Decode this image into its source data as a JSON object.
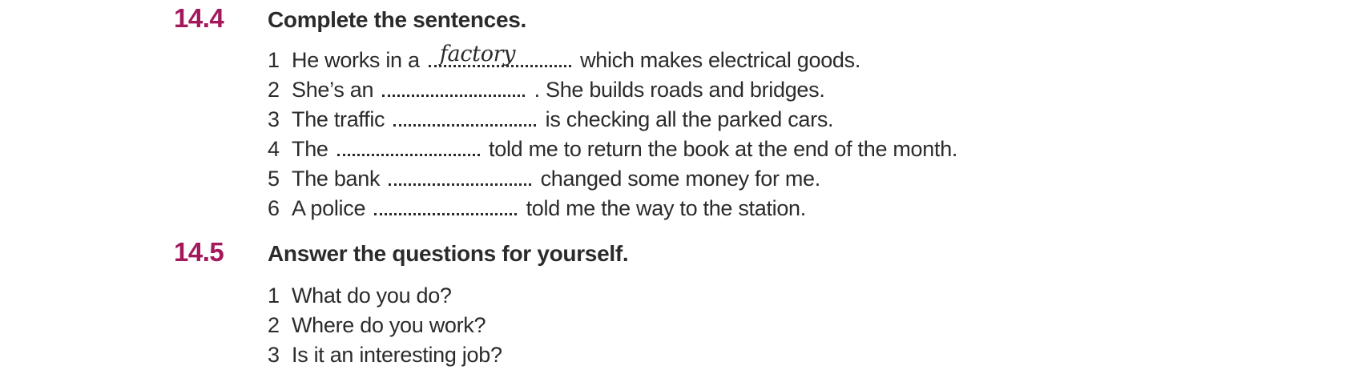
{
  "exercises": [
    {
      "number": "14.4",
      "title": "Complete the sentences.",
      "items": [
        {
          "num": "1",
          "before": "He works in a",
          "answer": "factory",
          "after": "which makes electrical goods."
        },
        {
          "num": "2",
          "before": "She’s an",
          "answer": "",
          "after": ". She builds roads and bridges."
        },
        {
          "num": "3",
          "before": "The traffic",
          "answer": "",
          "after": "is checking all the parked cars."
        },
        {
          "num": "4",
          "before": "The",
          "answer": "",
          "after": "told me to return the book at the end of the month."
        },
        {
          "num": "5",
          "before": "The bank",
          "answer": "",
          "after": "changed some money for me."
        },
        {
          "num": "6",
          "before": "A police",
          "answer": "",
          "after": "told me the way to the station."
        }
      ]
    },
    {
      "number": "14.5",
      "title": "Answer the questions for yourself.",
      "items": [
        {
          "num": "1",
          "text": "What do you do?"
        },
        {
          "num": "2",
          "text": "Where do you work?"
        },
        {
          "num": "3",
          "text": "Is it an interesting job?"
        }
      ]
    }
  ]
}
